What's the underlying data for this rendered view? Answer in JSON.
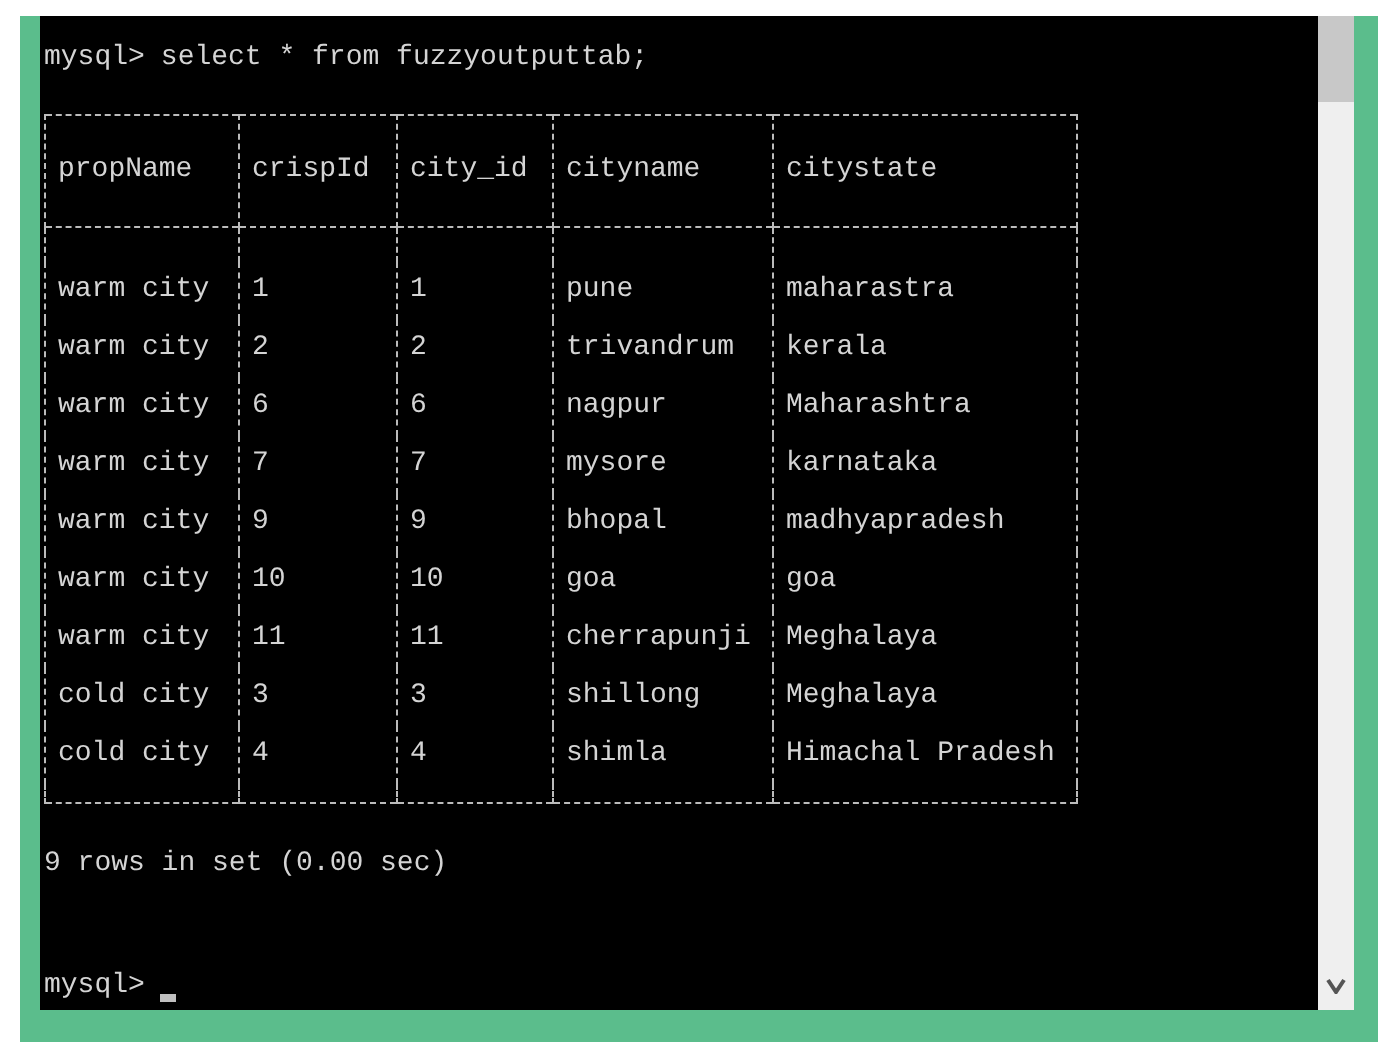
{
  "console": {
    "command_prompt": "mysql>",
    "command": "select * from fuzzyoutputtab;",
    "table": {
      "columns": [
        "propName",
        "crispId",
        "city_id",
        "cityname",
        "citystate"
      ],
      "rows": [
        [
          "warm city",
          "1",
          "1",
          "pune",
          "maharastra"
        ],
        [
          "warm city",
          "2",
          "2",
          "trivandrum",
          "kerala"
        ],
        [
          "warm city",
          "6",
          "6",
          "nagpur",
          "Maharashtra"
        ],
        [
          "warm city",
          "7",
          "7",
          "mysore",
          "karnataka"
        ],
        [
          "warm city",
          "9",
          "9",
          "bhopal",
          "madhyapradesh"
        ],
        [
          "warm city",
          "10",
          "10",
          "goa",
          "goa"
        ],
        [
          "warm city",
          "11",
          "11",
          "cherrapunji",
          "Meghalaya"
        ],
        [
          "cold city",
          "3",
          "3",
          "shillong",
          "Meghalaya"
        ],
        [
          "cold city",
          "4",
          "4",
          "shimla",
          "Himachal Pradesh"
        ]
      ]
    },
    "result_summary": "9 rows in set (0.00 sec)",
    "prompt": "mysql>"
  }
}
